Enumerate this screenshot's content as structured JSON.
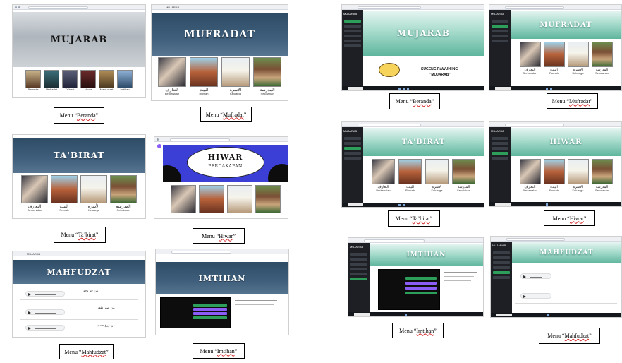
{
  "captions": {
    "beranda_l": {
      "prefix": "Menu “",
      "name": "Beranda",
      "suffix": "”"
    },
    "mufradat_l": {
      "prefix": "Menu “",
      "name": "Mufradat",
      "suffix": "”"
    },
    "tabirat_l": {
      "prefix": "Menu “",
      "name": "Ta’birat",
      "suffix": "”"
    },
    "hiwar_l": {
      "prefix": "Menu “",
      "name": "Hiwar",
      "suffix": "”"
    },
    "mahfudzat_l": {
      "prefix": "Menu “",
      "name": "Mahfudzat",
      "suffix": "”"
    },
    "imtihan_l": {
      "prefix": "Menu “",
      "name": "Imtihan",
      "suffix": "”"
    },
    "beranda_r": {
      "prefix": "Menu “",
      "name": "Beranda",
      "suffix": "”"
    },
    "mufradat_r": {
      "prefix": "Menu “",
      "name": "Mufradat",
      "suffix": "”"
    },
    "tabirat_r": {
      "prefix": "Menu “",
      "name": "Ta’birat",
      "suffix": "”"
    },
    "hiwar_r": {
      "prefix": "Menu “",
      "name": "Hiwar",
      "suffix": "”"
    },
    "imtihan_r": {
      "prefix": "Menu “",
      "name": "Imtihan",
      "suffix": "”"
    },
    "mahfudzat_r": {
      "prefix": "Menu “",
      "name": "Mahfudzat",
      "suffix": "”"
    }
  },
  "banners": {
    "mujarab": "MUJARAB",
    "mufradat": "MUFRADAT",
    "tabirat": "TA'BIRAT",
    "hiwar": "HIWAR",
    "hiwar_sub": "PERCAKAPAN",
    "mahfudzat": "MAHFUDZAT",
    "imtihan": "IMTIHAN",
    "r_mujarab": "MUJARAB",
    "r_mufradat": "MUFRADAT",
    "r_tabirat": "TA'BIRAT",
    "r_hiwar": "HIWAR",
    "r_imtihan": "IMTIHAN",
    "r_mahfudzat": "MAHFUDZAT",
    "r_greeting": "SUGENG RAWUH ING",
    "r_greeting2": "\"MUJARAB\"",
    "app_tab": "MUJARAB",
    "side_brand": "MUJARAB"
  },
  "categories": [
    {
      "arabic": "التعارف",
      "latin": "Berkenalan"
    },
    {
      "arabic": "البيت",
      "latin": "Rumah"
    },
    {
      "arabic": "الأسرة",
      "latin": "Keluarga"
    },
    {
      "arabic": "المدرسة",
      "latin": "Sekolahan"
    }
  ],
  "beranda_menu": [
    "Beranda",
    "Mufradat",
    "Ta'birat",
    "Hiwar",
    "Mahfudzat",
    "Imtihan"
  ],
  "audio_time": "0:00 / 0:00",
  "colors": {
    "slate": "#2f4c66",
    "teal": "#5fb59d",
    "sidebar": "#1d1f24",
    "caption_underline": "#d42a2a"
  }
}
